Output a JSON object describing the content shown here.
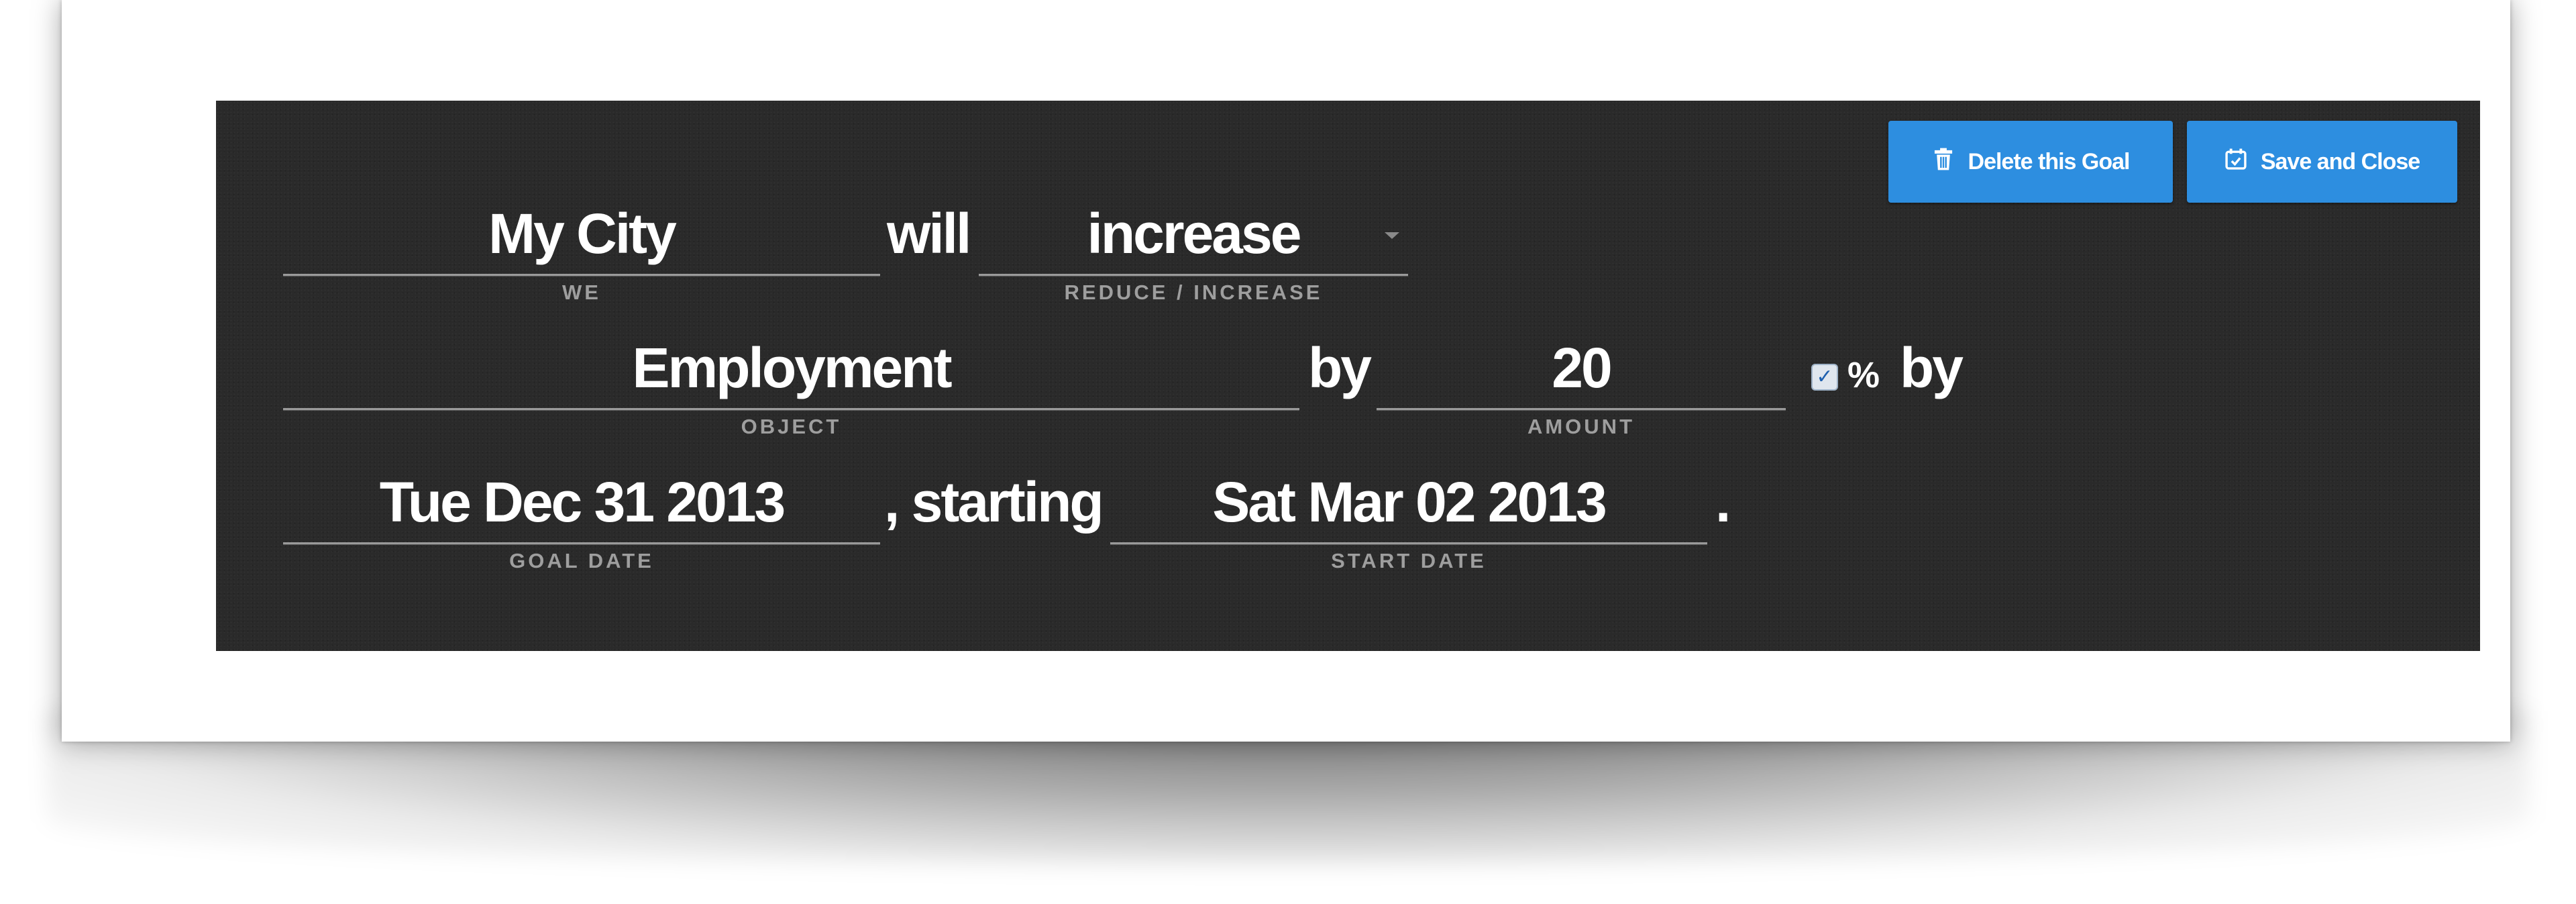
{
  "actions": {
    "delete_label": "Delete this Goal",
    "save_label": "Save and Close"
  },
  "goal": {
    "we": {
      "value": "My City",
      "caption": "WE"
    },
    "will_word": "will",
    "direction": {
      "value": "increase",
      "caption": "REDUCE / INCREASE"
    },
    "object": {
      "value": "Employment",
      "caption": "OBJECT"
    },
    "by_word": "by",
    "amount": {
      "value": "20",
      "caption": "AMOUNT"
    },
    "percent": {
      "checked": true,
      "symbol": "%",
      "by_word": "by"
    },
    "goal_date": {
      "value": "Tue Dec 31 2013",
      "caption": "GOAL DATE"
    },
    "starting_word": ", starting",
    "start_date": {
      "value": "Sat Mar 02 2013",
      "caption": "START DATE"
    },
    "period": "."
  },
  "colors": {
    "panel_bg": "#2a2a2a",
    "button_bg": "#2d8ee0",
    "text": "#ffffff",
    "caption": "#9e9e9e"
  }
}
